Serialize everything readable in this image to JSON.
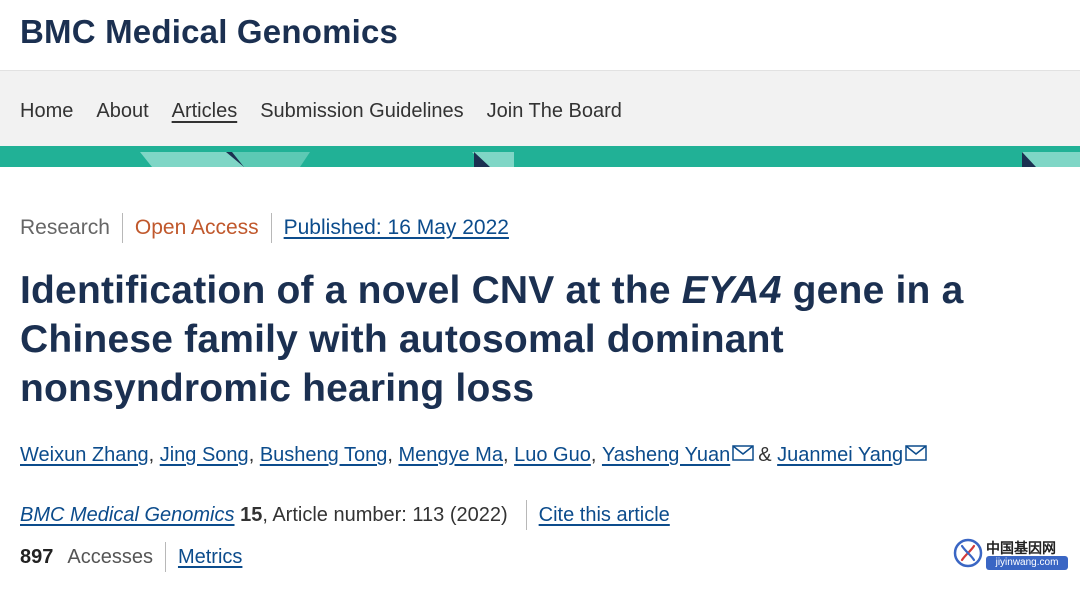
{
  "header": {
    "journal_title": "BMC Medical Genomics"
  },
  "nav": {
    "items": [
      {
        "label": "Home",
        "active": false
      },
      {
        "label": "About",
        "active": false
      },
      {
        "label": "Articles",
        "active": true
      },
      {
        "label": "Submission Guidelines",
        "active": false
      },
      {
        "label": "Join The Board",
        "active": false
      }
    ]
  },
  "article": {
    "type": "Research",
    "access": "Open Access",
    "published": "Published: 16 May 2022",
    "title_before": "Identification of a novel CNV at the ",
    "title_gene": "EYA4",
    "title_after": " gene in a Chinese family with autosomal dominant nonsyndromic hearing loss",
    "authors": [
      "Weixun Zhang",
      "Jing Song",
      "Busheng Tong",
      "Mengye Ma",
      "Luo Guo",
      "Yasheng Yuan",
      "Juanmei Yang"
    ],
    "author_separator": ",",
    "author_last_separator": "&",
    "citation": {
      "journal": "BMC Medical Genomics",
      "volume": "15",
      "rest": ", Article number: 113 (2022)",
      "cite_link": "Cite this article"
    },
    "accesses_count": "897",
    "accesses_label": "Accesses",
    "metrics_link": "Metrics"
  },
  "watermark": {
    "cn_text": "中国基因网",
    "url": "jiyinwang.com"
  },
  "colors": {
    "brand_navy": "#1b3051",
    "link_blue": "#0c4c8c",
    "open_access": "#c0582c",
    "band_teal": "#21b196"
  }
}
